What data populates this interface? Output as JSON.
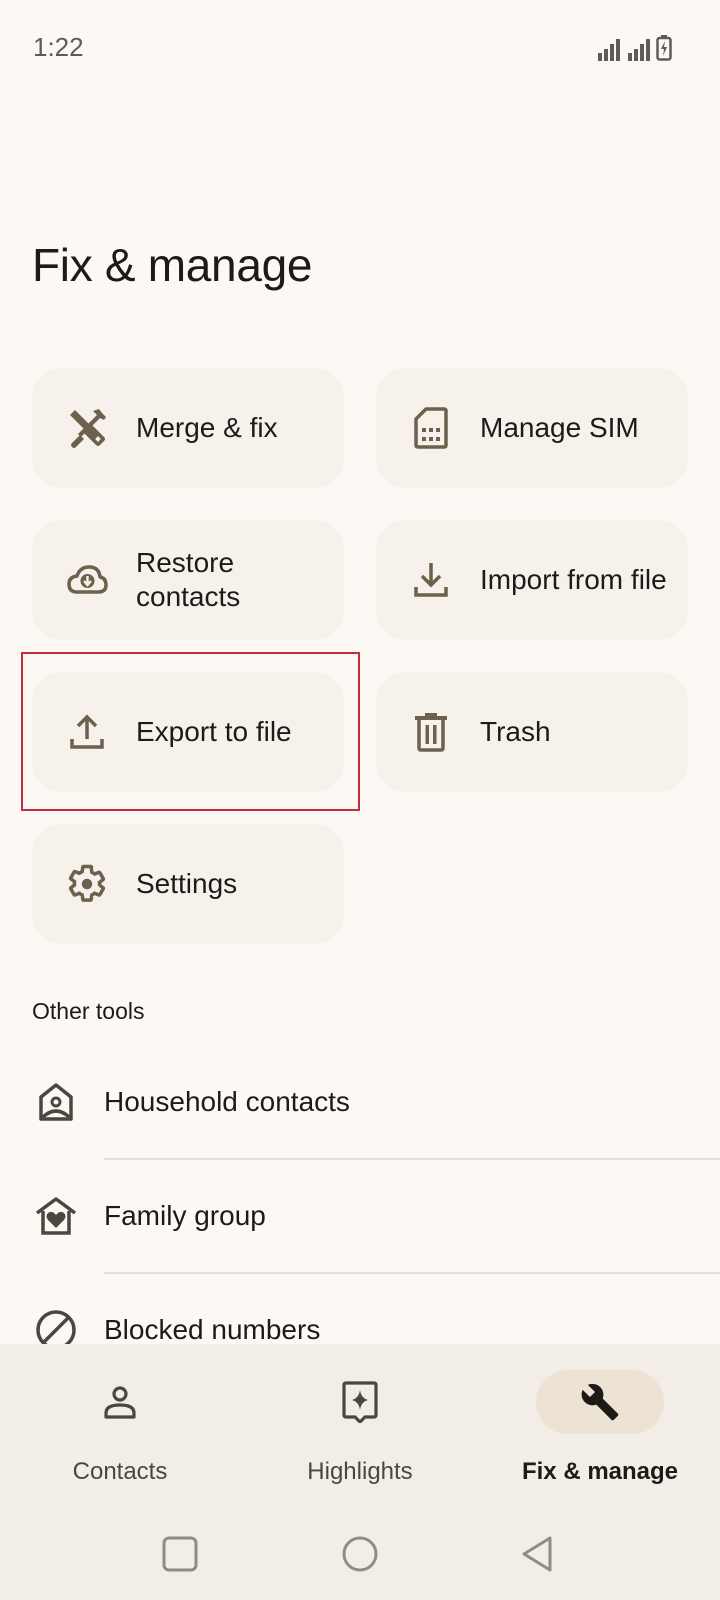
{
  "status_bar": {
    "time": "1:22",
    "icons": [
      "signal-icon",
      "signal-icon",
      "battery-charging-icon"
    ]
  },
  "page": {
    "title": "Fix & manage"
  },
  "cards": [
    {
      "label": "Merge & fix",
      "icon": "merge-fix-icon"
    },
    {
      "label": "Manage SIM",
      "icon": "sim-card-icon"
    },
    {
      "label": "Restore contacts",
      "icon": "cloud-download-icon"
    },
    {
      "label": "Import from file",
      "icon": "download-icon"
    },
    {
      "label": "Export to file",
      "icon": "upload-icon"
    },
    {
      "label": "Trash",
      "icon": "trash-icon"
    },
    {
      "label": "Settings",
      "icon": "gear-icon"
    }
  ],
  "other_tools": {
    "heading": "Other tools",
    "items": [
      {
        "label": "Household contacts",
        "icon": "household-icon"
      },
      {
        "label": "Family group",
        "icon": "family-home-icon"
      },
      {
        "label": "Blocked numbers",
        "icon": "block-icon"
      }
    ]
  },
  "bottom_nav": {
    "items": [
      {
        "label": "Contacts",
        "icon": "person-icon",
        "active": false
      },
      {
        "label": "Highlights",
        "icon": "highlights-icon",
        "active": false
      },
      {
        "label": "Fix & manage",
        "icon": "wrench-icon",
        "active": true
      }
    ]
  },
  "system_nav": {
    "buttons": [
      "recents",
      "home",
      "back"
    ]
  },
  "colors": {
    "background": "#fcf8f3",
    "card": "#f6f1eb",
    "icon": "#6b614d",
    "active_pill": "#ede3d4",
    "highlight": "#c0303a"
  }
}
